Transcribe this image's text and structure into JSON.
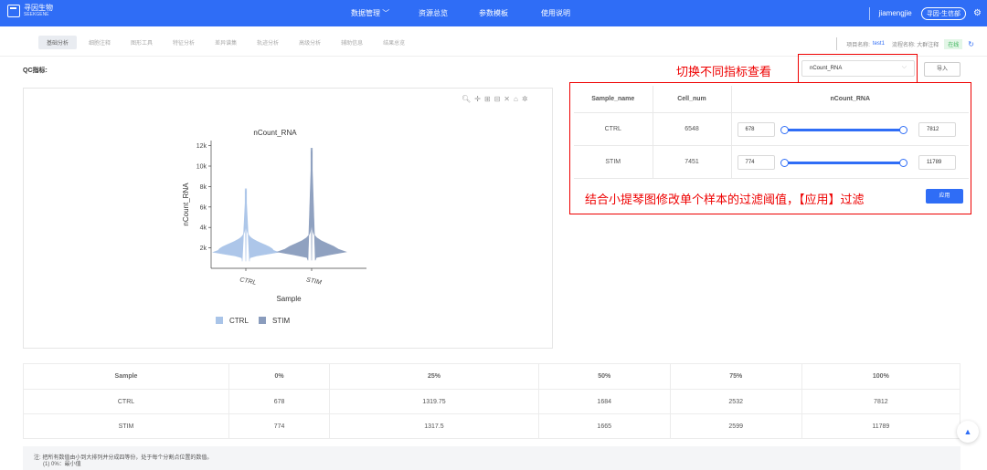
{
  "app": {
    "logo_text": "寻因生物",
    "logo_sub": "SEEKGENE"
  },
  "topnav": {
    "items": [
      {
        "label": "数据管理 ﹀"
      },
      {
        "label": "资源总览"
      },
      {
        "label": "参数模板"
      },
      {
        "label": "使用说明"
      }
    ],
    "username": "jiamengjie",
    "org": "寻因-生信部"
  },
  "subnav": {
    "tabs": [
      "基础分析",
      "细胞注释",
      "图形工具",
      "特征分析",
      "差异谱集",
      "轨迹分析",
      "高级分析",
      "辅助信息",
      "结果总览"
    ],
    "project_label": "项目名称:",
    "project_value": "test1",
    "flow_label": "流程名称: 大群注释",
    "status": "在线"
  },
  "qc": {
    "label": "QC指标:",
    "annotation_switch": "切换不同指标查看",
    "selected_metric": "nCount_RNA",
    "import_label": "导入"
  },
  "filter": {
    "headers": [
      "Sample_name",
      "Cell_num",
      "nCount_RNA"
    ],
    "rows": [
      {
        "sample": "CTRL",
        "cells": "6548",
        "min": "678",
        "max": "7812"
      },
      {
        "sample": "STIM",
        "cells": "7451",
        "min": "774",
        "max": "11789"
      }
    ],
    "annotation_apply": "结合小提琴图修改单个样本的过滤阈值，【应用】过滤",
    "apply_label": "应用"
  },
  "chart_data": {
    "type": "violin",
    "title": "nCount_RNA",
    "xlabel": "Sample",
    "ylabel": "nCount_RNA",
    "categories": [
      "CTRL",
      "STIM"
    ],
    "yticks": [
      "2k",
      "4k",
      "6k",
      "8k",
      "10k",
      "12k"
    ],
    "ylim": [
      0,
      12500
    ],
    "series": [
      {
        "name": "CTRL",
        "color": "#a9c4e8",
        "min": 678,
        "median": 1684,
        "max": 7812
      },
      {
        "name": "STIM",
        "color": "#8a9cbd",
        "min": 774,
        "median": 1665,
        "max": 11789
      }
    ],
    "legend": "bottom"
  },
  "quantile": {
    "headers": [
      "Sample",
      "0%",
      "25%",
      "50%",
      "75%",
      "100%"
    ],
    "rows": [
      [
        "CTRL",
        "678",
        "1319.75",
        "1684",
        "2532",
        "7812"
      ],
      [
        "STIM",
        "774",
        "1317.5",
        "1665",
        "2599",
        "11789"
      ]
    ],
    "note_line1": "注: 把所有数值由小到大排列并分成四等份，处于每个分割点位置的数值。",
    "note_line2": "(1) 0%：最小值"
  },
  "colors": {
    "primary": "#2f6df6",
    "annotation": "#ee0000"
  }
}
